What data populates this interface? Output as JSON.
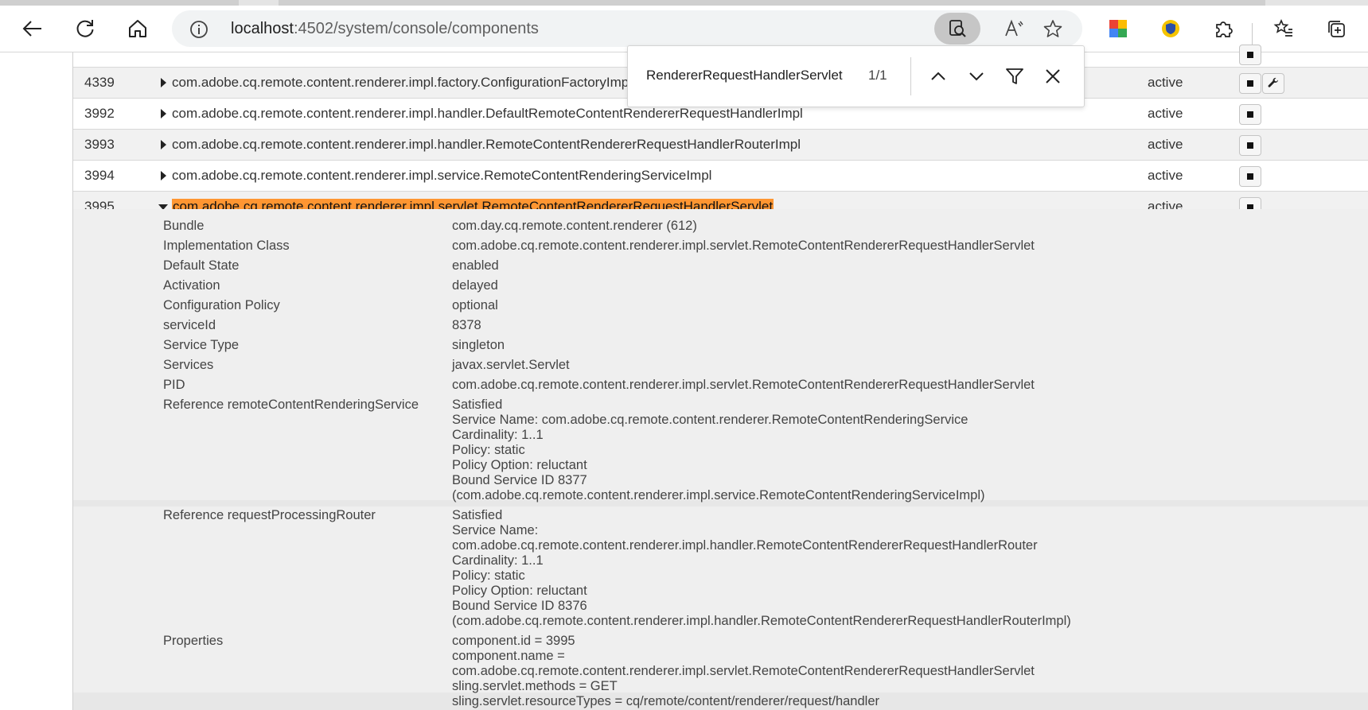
{
  "browser": {
    "url_host": "localhost",
    "url_rest": ":4502/system/console/components"
  },
  "find": {
    "query": "RendererRequestHandlerServlet",
    "count": "1/1"
  },
  "rows": [
    {
      "id": "4339",
      "name": "com.adobe.cq.remote.content.renderer.impl.factory.ConfigurationFactoryImpl",
      "status": "active"
    },
    {
      "id": "3992",
      "name": "com.adobe.cq.remote.content.renderer.impl.handler.DefaultRemoteContentRendererRequestHandlerImpl",
      "status": "active"
    },
    {
      "id": "3993",
      "name": "com.adobe.cq.remote.content.renderer.impl.handler.RemoteContentRendererRequestHandlerRouterImpl",
      "status": "active"
    },
    {
      "id": "3994",
      "name": "com.adobe.cq.remote.content.renderer.impl.service.RemoteContentRenderingServiceImpl",
      "status": "active"
    },
    {
      "id": "3995",
      "name": "com.adobe.cq.remote.content.renderer.impl.servlet.RemoteContentRendererRequestHandlerServlet",
      "status": "active"
    }
  ],
  "details": [
    {
      "label": "Bundle",
      "value": [
        "com.day.cq.remote.content.renderer (612)"
      ]
    },
    {
      "label": "Implementation Class",
      "value": [
        "com.adobe.cq.remote.content.renderer.impl.servlet.RemoteContentRendererRequestHandlerServlet"
      ]
    },
    {
      "label": "Default State",
      "value": [
        "enabled"
      ]
    },
    {
      "label": "Activation",
      "value": [
        "delayed"
      ]
    },
    {
      "label": "Configuration Policy",
      "value": [
        "optional"
      ]
    },
    {
      "label": "serviceId",
      "value": [
        "8378"
      ]
    },
    {
      "label": "Service Type",
      "value": [
        "singleton"
      ]
    },
    {
      "label": "Services",
      "value": [
        "javax.servlet.Servlet"
      ]
    },
    {
      "label": "PID",
      "value": [
        "com.adobe.cq.remote.content.renderer.impl.servlet.RemoteContentRendererRequestHandlerServlet"
      ]
    },
    {
      "label": "Reference remoteContentRenderingService",
      "value": [
        "Satisfied",
        "Service Name: com.adobe.cq.remote.content.renderer.RemoteContentRenderingService",
        "Cardinality: 1..1",
        "Policy: static",
        "Policy Option: reluctant",
        "Bound Service ID 8377",
        "(com.adobe.cq.remote.content.renderer.impl.service.RemoteContentRenderingServiceImpl)"
      ]
    },
    {
      "label": "Reference requestProcessingRouter",
      "value": [
        "Satisfied",
        "Service Name:",
        "com.adobe.cq.remote.content.renderer.impl.handler.RemoteContentRendererRequestHandlerRouter",
        "Cardinality: 1..1",
        "Policy: static",
        "Policy Option: reluctant",
        "Bound Service ID 8376",
        "(com.adobe.cq.remote.content.renderer.impl.handler.RemoteContentRendererRequestHandlerRouterImpl)"
      ]
    },
    {
      "label": "Properties",
      "value": [
        "component.id = 3995",
        "component.name =",
        "com.adobe.cq.remote.content.renderer.impl.servlet.RemoteContentRendererRequestHandlerServlet",
        "sling.servlet.methods = GET",
        "sling.servlet.resourceTypes = cq/remote/content/renderer/request/handler"
      ]
    }
  ]
}
